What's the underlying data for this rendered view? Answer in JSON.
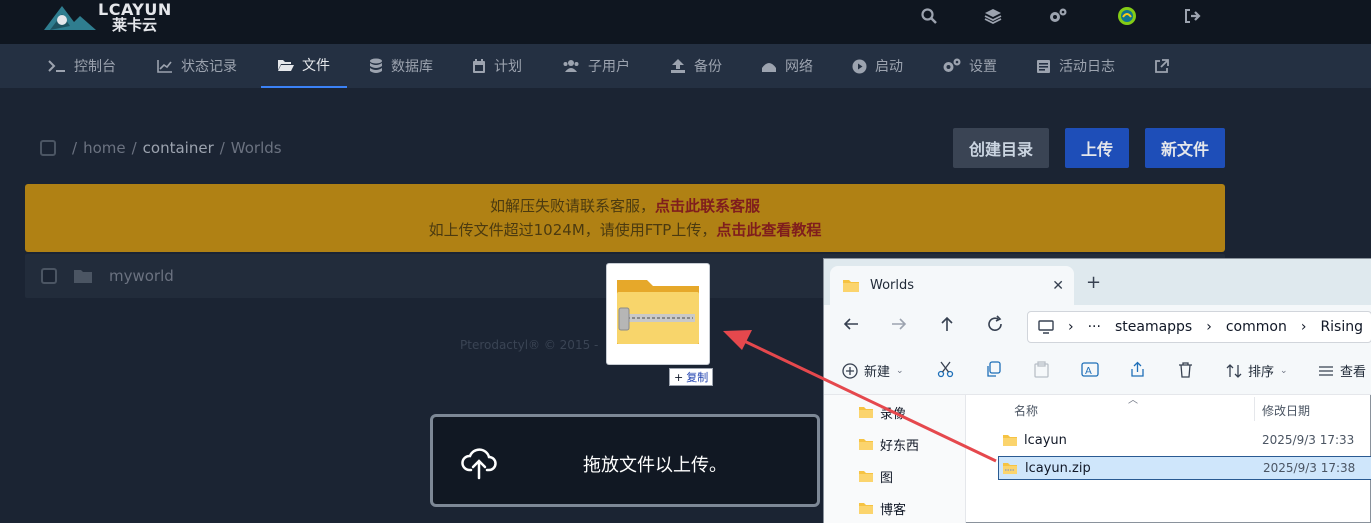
{
  "header": {
    "brand": "LCAYUN",
    "brand_cn": "莱卡云",
    "icons": [
      "search-icon",
      "layers-icon",
      "cogs-icon",
      "avatar",
      "logout-icon"
    ]
  },
  "nav": {
    "items": [
      {
        "label": "控制台",
        "icon": "terminal-icon"
      },
      {
        "label": "状态记录",
        "icon": "chart-icon"
      },
      {
        "label": "文件",
        "icon": "folder-open-icon",
        "active": true
      },
      {
        "label": "数据库",
        "icon": "database-icon"
      },
      {
        "label": "计划",
        "icon": "calendar-icon"
      },
      {
        "label": "子用户",
        "icon": "users-icon"
      },
      {
        "label": "备份",
        "icon": "upload-icon"
      },
      {
        "label": "网络",
        "icon": "network-icon"
      },
      {
        "label": "启动",
        "icon": "play-icon"
      },
      {
        "label": "设置",
        "icon": "cogs-icon"
      },
      {
        "label": "活动日志",
        "icon": "log-icon"
      },
      {
        "label": "",
        "icon": "external-link-icon"
      }
    ]
  },
  "breadcrumb": {
    "sep": "/",
    "parts": [
      "home",
      "container",
      "Worlds"
    ]
  },
  "actions": {
    "create_dir": "创建目录",
    "upload": "上传",
    "new_file": "新文件"
  },
  "banner": {
    "line1_text": "如解压失败请联系客服，",
    "line1_link": "点击此联系客服",
    "line2_text": "如上传文件超过1024M，请使用FTP上传，",
    "line2_link": "点击此查看教程"
  },
  "files": [
    {
      "name": "myworld"
    }
  ],
  "footer": {
    "text": "Pterodactyl® © 2015 -"
  },
  "drag": {
    "copy_label": "复制"
  },
  "dropzone": {
    "label": "拖放文件以上传。"
  },
  "explorer": {
    "tab_title": "Worlds",
    "path": [
      "steamapps",
      "common",
      "Rising"
    ],
    "toolbar": {
      "new": "新建",
      "sort": "排序",
      "view": "查看"
    },
    "sidebar": [
      "录像",
      "好东西",
      "图",
      "博客"
    ],
    "columns": {
      "name": "名称",
      "modified": "修改日期"
    },
    "rows": [
      {
        "name": "lcayun",
        "modified": "2025/9/3 17:33",
        "type": "folder"
      },
      {
        "name": "lcayun.zip",
        "modified": "2025/9/3 17:38",
        "type": "zip",
        "selected": true
      }
    ]
  },
  "colors": {
    "accent": "#3b82f6",
    "banner": "#b08114",
    "link_red": "#7f1d1d",
    "arrow_red": "#e5484d"
  }
}
